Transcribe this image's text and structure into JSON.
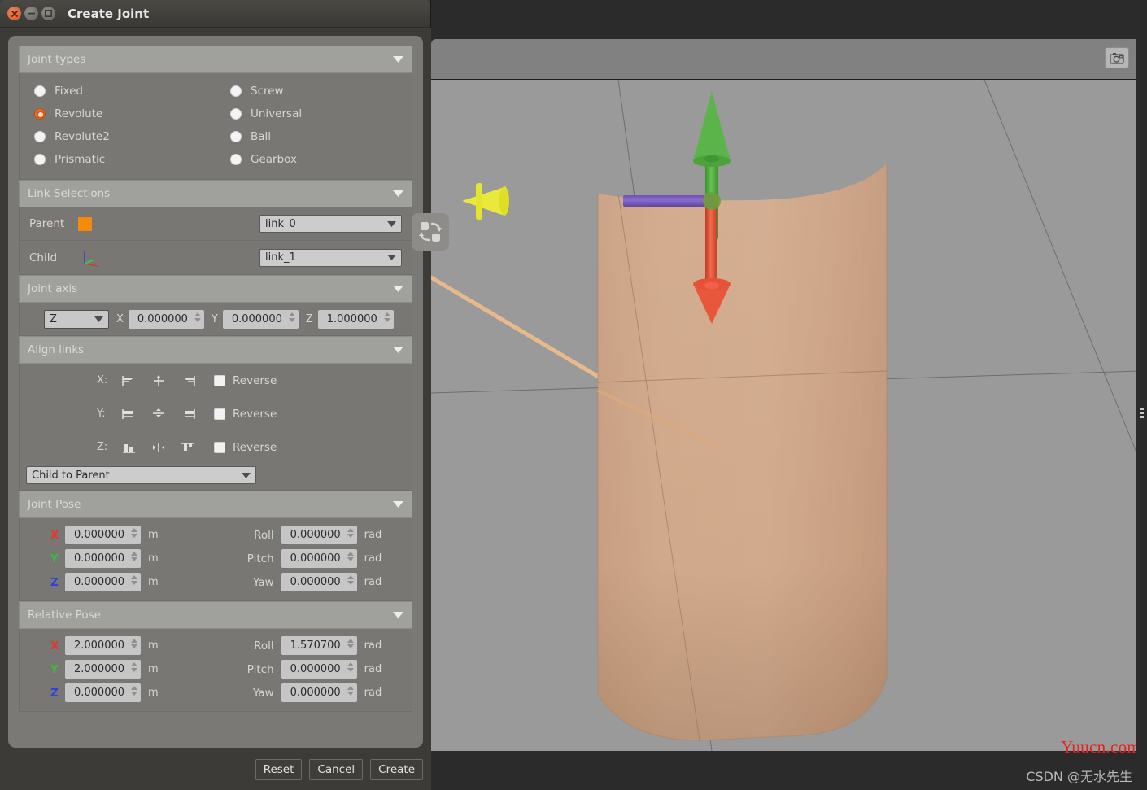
{
  "window": {
    "title": "Create Joint",
    "controls": {
      "close": "close-button",
      "minimize": "minimize-button",
      "maximize": "maximize-button"
    }
  },
  "joint_types": {
    "header": "Joint types",
    "selected": "Revolute",
    "left_column": [
      "Fixed",
      "Revolute",
      "Revolute2",
      "Prismatic"
    ],
    "right_column": [
      "Screw",
      "Universal",
      "Ball",
      "Gearbox"
    ]
  },
  "link_selections": {
    "header": "Link Selections",
    "parent_label": "Parent",
    "parent_value": "link_0",
    "parent_color": "#f58a0b",
    "child_label": "Child",
    "child_value": "link_1",
    "swap_button": "swap-links-button"
  },
  "joint_axis": {
    "header": "Joint axis",
    "preset": "Z",
    "x_label": "X",
    "x_value": "0.000000",
    "y_label": "Y",
    "y_value": "0.000000",
    "z_label": "Z",
    "z_value": "1.000000"
  },
  "align_links": {
    "header": "Align links",
    "rows": [
      {
        "axis": "X:",
        "reverse_label": "Reverse",
        "reverse_checked": false
      },
      {
        "axis": "Y:",
        "reverse_label": "Reverse",
        "reverse_checked": false
      },
      {
        "axis": "Z:",
        "reverse_label": "Reverse",
        "reverse_checked": false
      }
    ],
    "direction": "Child to Parent"
  },
  "joint_pose": {
    "header": "Joint Pose",
    "x_label": "X",
    "x_value": "0.000000",
    "x_unit": "m",
    "y_label": "Y",
    "y_value": "0.000000",
    "y_unit": "m",
    "z_label": "Z",
    "z_value": "0.000000",
    "z_unit": "m",
    "roll_label": "Roll",
    "roll_value": "0.000000",
    "roll_unit": "rad",
    "pitch_label": "Pitch",
    "pitch_value": "0.000000",
    "pitch_unit": "rad",
    "yaw_label": "Yaw",
    "yaw_value": "0.000000",
    "yaw_unit": "rad"
  },
  "relative_pose": {
    "header": "Relative Pose",
    "x_label": "X",
    "x_value": "2.000000",
    "x_unit": "m",
    "y_label": "Y",
    "y_value": "2.000000",
    "y_unit": "m",
    "z_label": "Z",
    "z_value": "0.000000",
    "z_unit": "m",
    "roll_label": "Roll",
    "roll_value": "1.570700",
    "roll_unit": "rad",
    "pitch_label": "Pitch",
    "pitch_value": "0.000000",
    "pitch_unit": "rad",
    "yaw_label": "Yaw",
    "yaw_value": "0.000000",
    "yaw_unit": "rad"
  },
  "footer": {
    "reset": "Reset",
    "cancel": "Cancel",
    "create": "Create"
  },
  "viewport": {
    "screenshot_button": "camera-icon",
    "scene_description": "3d-cylinder-with-joint-axis-gizmo",
    "model_color": "#c9a183",
    "background_color": "#9a9a9a",
    "gizmo": {
      "up_arrow_color": "#4eaa3c",
      "down_arrow_color": "#e04a31",
      "bar_color": "#7a5fbf",
      "side_arrow_color": "#e8e82a",
      "guide_line_color": "#e8b98a"
    }
  },
  "watermarks": {
    "red": "Yuucn.com",
    "bottom": "CSDN @无水先生"
  }
}
